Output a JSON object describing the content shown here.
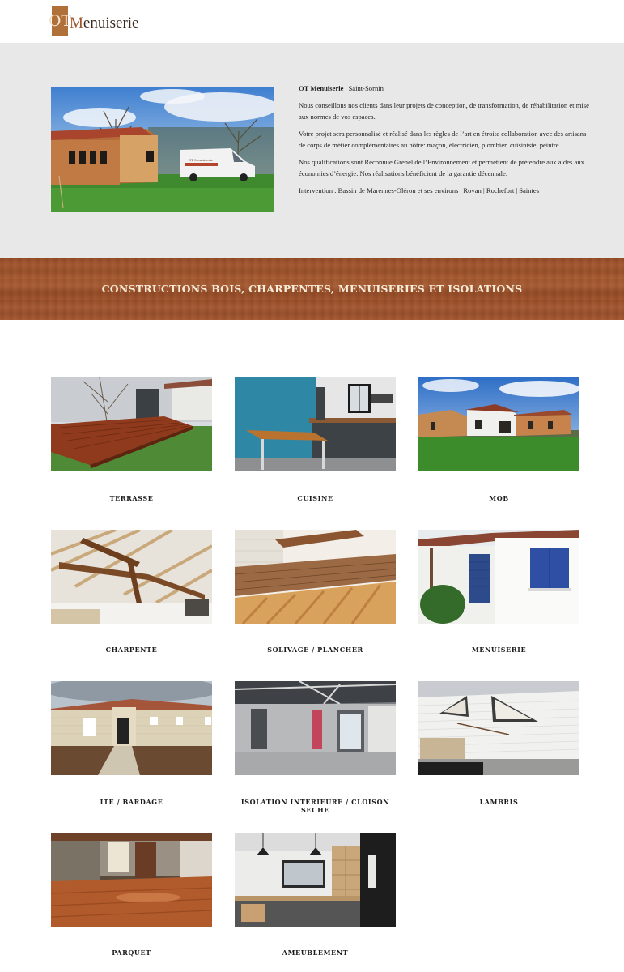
{
  "header": {
    "logo_mark": "OT",
    "logo_text_1": "M",
    "logo_text_2": "enuiserie",
    "brand_color": "#b0703a"
  },
  "intro": {
    "company": "OT Menuiserie",
    "location": "| Saint-Sornin",
    "p1": "Nous conseillons nos clients dans leur projets de conception, de transformation, de réhabilitation et mise aux normes de vos espaces.",
    "p2": "Votre projet sera personnalisé et réalisé dans les règles de l’art en étroite collaboration avec des artisans de corps de métier complémentaires au nôtre: maçon, électricien, plombier, cuisiniste, peintre.",
    "p3": "Nos qualifications sont Reconnue Grenel de l’Environnement et permettent de prétendre aux aides aux économies d’énergie. Nos réalisations bénéficient de la garantie décennale.",
    "p4": "Intervention : Bassin de Marennes-Oléron et ses environs | Royan | Rochefort | Saintes",
    "van_text": "OT Menuiserie"
  },
  "banner": {
    "title": "CONSTRUCTIONS BOIS, CHARPENTES, MENUISERIES ET ISOLATIONS",
    "wood_color": "#a0522d"
  },
  "gallery": {
    "items": [
      {
        "label": "TERRASSE"
      },
      {
        "label": "CUISINE"
      },
      {
        "label": "MOB"
      },
      {
        "label": "CHARPENTE"
      },
      {
        "label": "SOLIVAGE / PLANCHER"
      },
      {
        "label": "MENUISERIE"
      },
      {
        "label": "ITE / BARDAGE"
      },
      {
        "label": "ISOLATION INTERIEURE / CLOISON SECHE"
      },
      {
        "label": "LAMBRIS"
      },
      {
        "label": "PARQUET"
      },
      {
        "label": "AMEUBLEMENT"
      }
    ]
  }
}
